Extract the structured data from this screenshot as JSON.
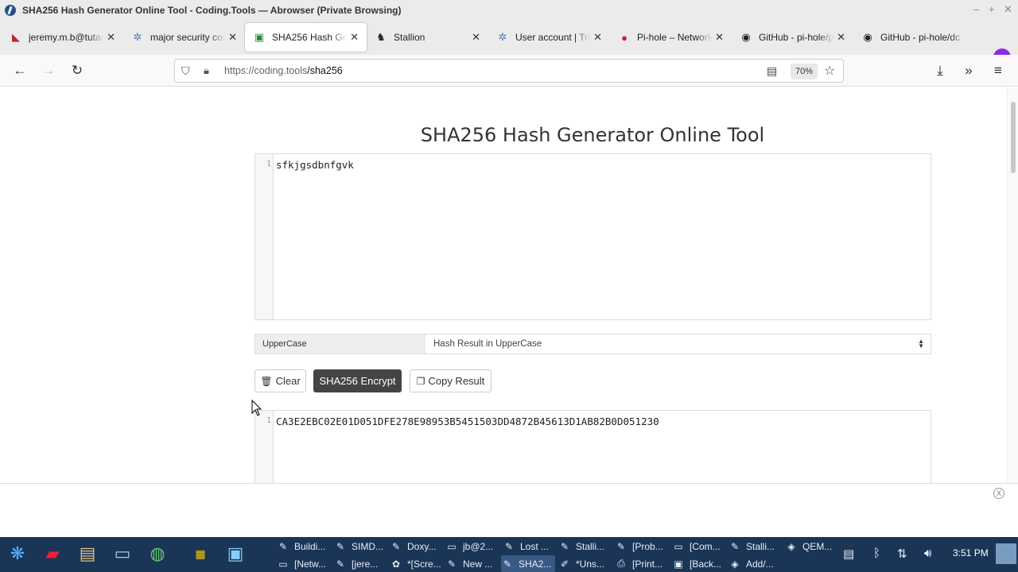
{
  "window": {
    "title": "SHA256 Hash Generator Online Tool - Coding.Tools — Abrowser (Private Browsing)"
  },
  "tabs": [
    {
      "label": "jeremy.m.b@tutan",
      "icon": "mail-icon",
      "color": "#c0262c"
    },
    {
      "label": "major security con",
      "icon": "bug-icon",
      "color": "#4a7fc1"
    },
    {
      "label": "SHA256 Hash Gen",
      "icon": "tool-icon",
      "color": "#2a8a3a"
    },
    {
      "label": "Stallion",
      "icon": "horse-icon",
      "color": "#222222"
    },
    {
      "label": "User account | Tris",
      "icon": "bug-icon",
      "color": "#4a7fc1"
    },
    {
      "label": "Pi-hole – Network",
      "icon": "raspberry-icon",
      "color": "#c51a4a"
    },
    {
      "label": "GitHub - pi-hole/pi",
      "icon": "github-icon",
      "color": "#222222"
    },
    {
      "label": "GitHub - pi-hole/dc",
      "icon": "github-icon",
      "color": "#222222"
    }
  ],
  "nav": {
    "url_host": "https://coding.tools",
    "url_path": "/sha256",
    "zoom": "70%"
  },
  "page": {
    "title": "SHA256 Hash Generator Online Tool",
    "input_line_no": "1",
    "input_text": "sfkjgsdbnfgvk",
    "option_label": "UpperCase",
    "option_value": "Hash Result in UpperCase",
    "clear_label": "Clear",
    "encrypt_label": "SHA256 Encrypt",
    "copy_label": "Copy Result",
    "output_line_no": "1",
    "output_text": "CA3E2EBC02E01D051DFE278E98953B5451503DD4872B45613D1AB82B0D051230"
  },
  "ad": {
    "close": "X"
  },
  "taskbar": {
    "row1": [
      "Buildi...",
      "SIMD...",
      "Doxy...",
      "jb@2...",
      "Lost ...",
      "Stalli...",
      "[Prob...",
      "[Com...",
      "Stalli...",
      "QEM..."
    ],
    "row2": [
      "[Netw...",
      "[jere...",
      "*[Scre...",
      "New ...",
      "SHA2...",
      "*Uns...",
      "[Print...",
      "[Back...",
      "Add/..."
    ],
    "clock": "3:51 PM"
  }
}
